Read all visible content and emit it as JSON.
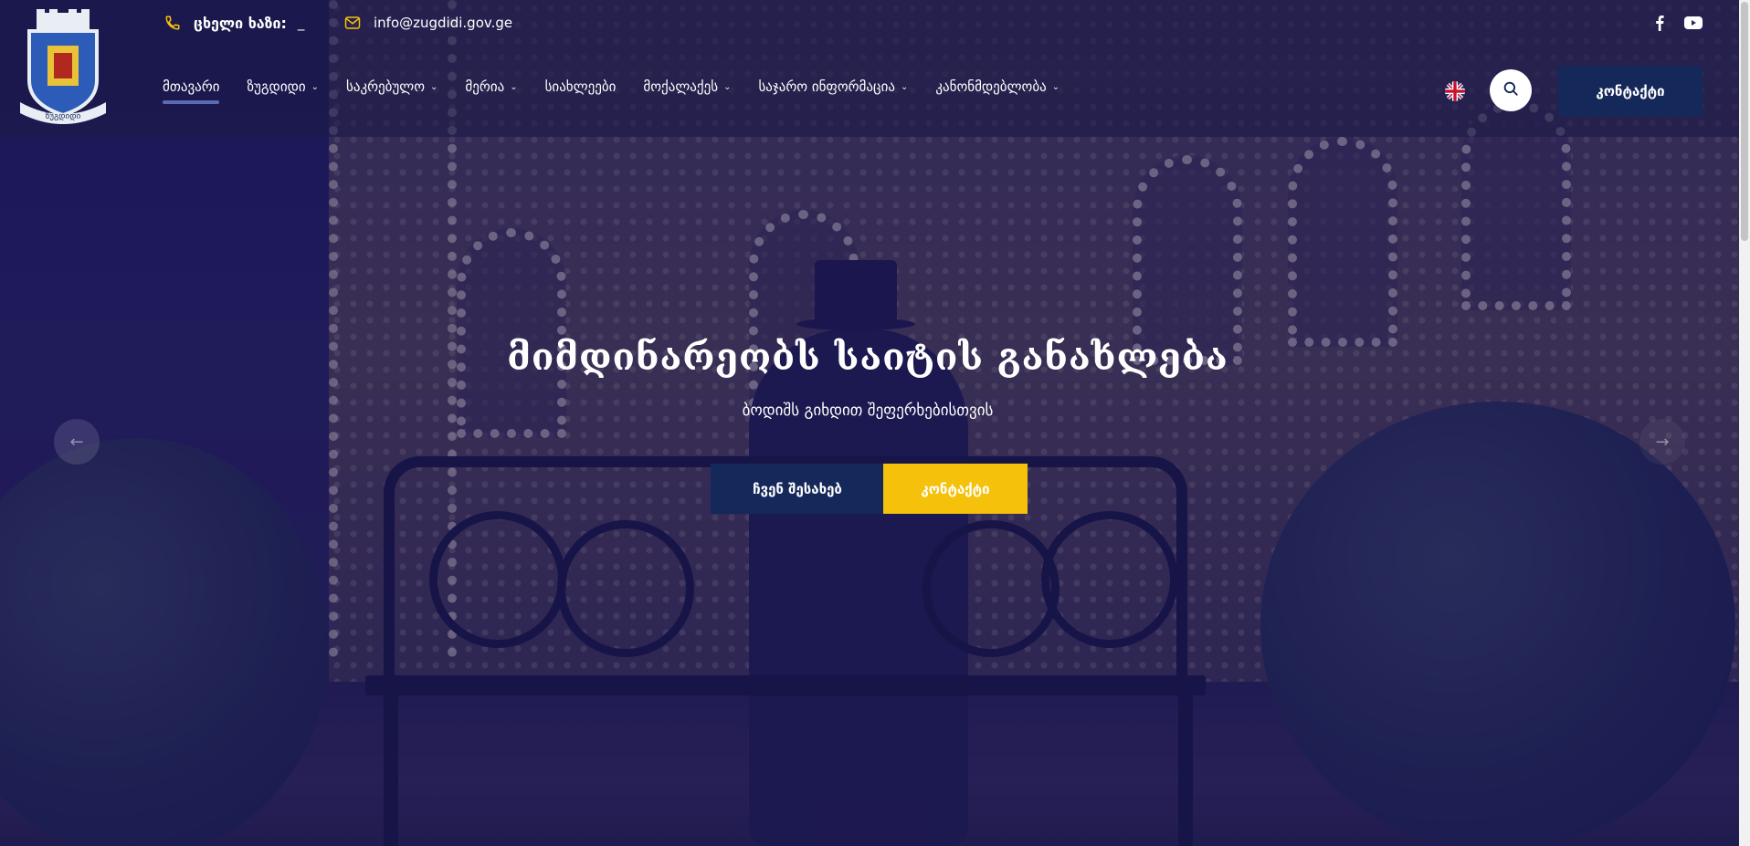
{
  "header": {
    "logo_alt": "ზუგდიდი",
    "hotline": {
      "label": "ცხელი ხაზი:",
      "value": "_",
      "icon": "phone-icon"
    },
    "email": {
      "value": "info@zugdidi.gov.ge",
      "icon": "mail-icon"
    },
    "social": [
      {
        "name": "facebook",
        "icon": "facebook-icon"
      },
      {
        "name": "youtube",
        "icon": "youtube-icon"
      }
    ],
    "nav": [
      {
        "label": "მთავარი",
        "dropdown": false,
        "active": true
      },
      {
        "label": "ზუგდიდი",
        "dropdown": true,
        "active": false
      },
      {
        "label": "საკრებულო",
        "dropdown": true,
        "active": false
      },
      {
        "label": "მერია",
        "dropdown": true,
        "active": false
      },
      {
        "label": "სიახლეები",
        "dropdown": false,
        "active": false
      },
      {
        "label": "მოქალაქეს",
        "dropdown": true,
        "active": false
      },
      {
        "label": "საჯარო ინფორმაცია",
        "dropdown": true,
        "active": false
      },
      {
        "label": "კანონმდებლობა",
        "dropdown": true,
        "active": false
      }
    ],
    "language_icon": "uk-flag-icon",
    "search_icon": "search-icon",
    "contact_label": "კონტაქტი"
  },
  "hero": {
    "title": "მიმდინარეობს საიტის განახლება",
    "subtitle": "ბოდიშს გიხდით შეფერხებისთვის",
    "about_label": "ჩვენ შესახებ",
    "contact_label": "კონტაქტი",
    "prev_icon": "arrow-left-icon",
    "next_icon": "arrow-right-icon"
  },
  "colors": {
    "navy": "#15285a",
    "yellow": "#f6c10a",
    "overlay": "#18145c"
  }
}
